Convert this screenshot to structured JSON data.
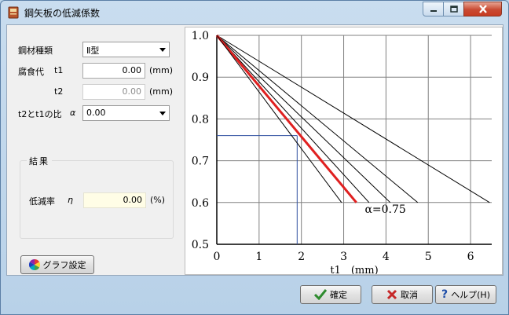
{
  "window": {
    "title": "鋼矢板の低減係数",
    "title_icon": "book-icon",
    "min_icon": "minimize-icon",
    "max_icon": "maximize-icon",
    "close_icon": "close-icon"
  },
  "form": {
    "steel_type_label": "鋼材種類",
    "steel_type_value": "Ⅱ型",
    "corrosion_label": "腐食代",
    "t1_label": "t1",
    "t1_value": "0.00",
    "t1_unit": "(mm)",
    "t2_label": "t2",
    "t2_value": "0.00",
    "t2_unit": "(mm)",
    "ratio_label": "t2とt1の比",
    "alpha_symbol": "α",
    "ratio_value": "0.00"
  },
  "result": {
    "group_title": "結果",
    "reduction_label": "低減率",
    "eta_symbol": "η",
    "reduction_value": "0.00",
    "reduction_unit": "(%)"
  },
  "buttons": {
    "graph_settings": "グラフ設定",
    "ok": "確定",
    "cancel": "取消",
    "help": "ヘルプ(H)"
  },
  "colors": {
    "highlight_line": "#e02020",
    "guide_line": "#3050a0",
    "grid": "#808080"
  },
  "chart_data": {
    "type": "line",
    "title": "",
    "xlabel": "t1　(mm)",
    "ylabel": "",
    "xlim": [
      0,
      6.5
    ],
    "ylim": [
      0.5,
      1.0
    ],
    "x_ticks": [
      "0",
      "1",
      "2",
      "3",
      "4",
      "5",
      "6"
    ],
    "y_ticks": [
      "1.0",
      "0.9",
      "0.8",
      "0.7",
      "0.6",
      "0.5"
    ],
    "grid": true,
    "series": [
      {
        "x": [
          0,
          6.45
        ],
        "y": [
          1.0,
          0.6
        ],
        "highlight": false
      },
      {
        "x": [
          0,
          4.75
        ],
        "y": [
          1.0,
          0.6
        ],
        "highlight": false
      },
      {
        "x": [
          0,
          4.1
        ],
        "y": [
          1.0,
          0.6
        ],
        "highlight": false
      },
      {
        "x": [
          0,
          3.6
        ],
        "y": [
          1.0,
          0.6
        ],
        "highlight": false
      },
      {
        "x": [
          0,
          3.3
        ],
        "y": [
          1.0,
          0.6
        ],
        "highlight": true
      },
      {
        "x": [
          0,
          2.95
        ],
        "y": [
          1.0,
          0.6
        ],
        "highlight": false
      }
    ],
    "guide": {
      "x": 1.9,
      "y": 0.76
    },
    "annotation": {
      "text": "α=0.75",
      "x": 3.5,
      "y": 0.575
    }
  }
}
